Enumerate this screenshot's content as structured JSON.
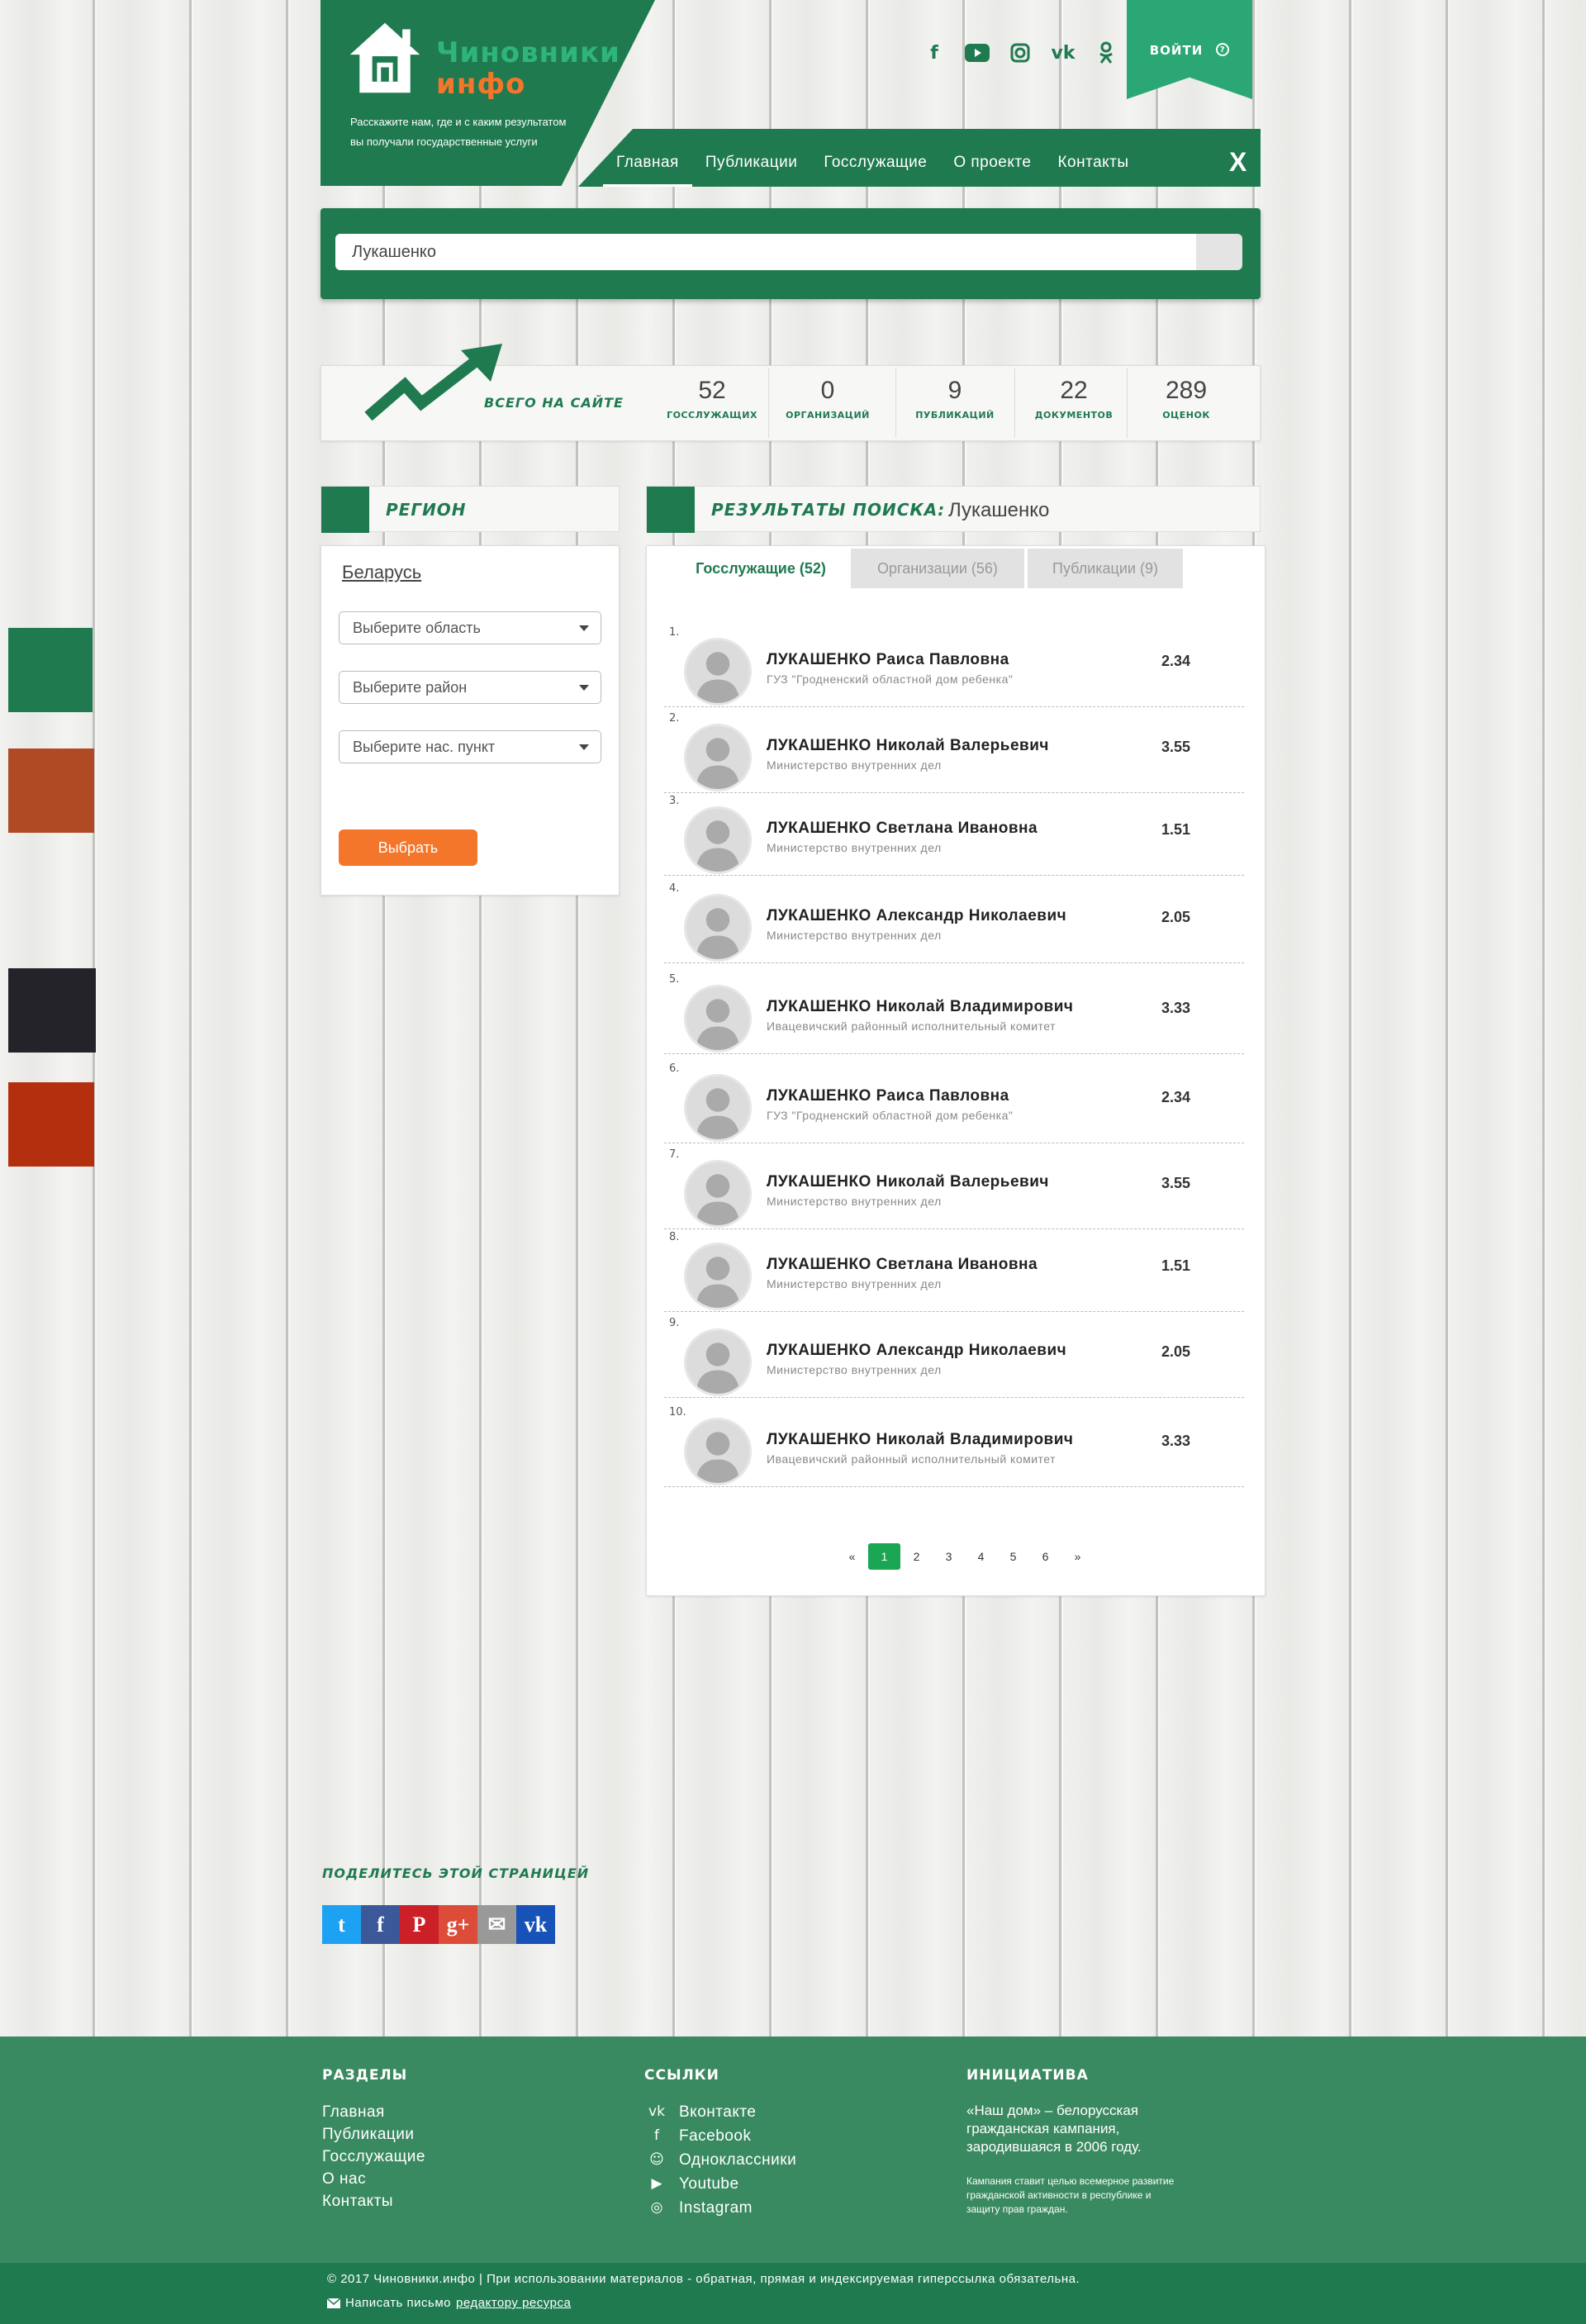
{
  "header": {
    "logo_line1": "Чиновники",
    "logo_line2": "инфо",
    "tagline": "Расскажите нам, где и с каким результатом вы получали государственные услуги",
    "login_label": "войти",
    "help_symbol": "?",
    "close_label": "X",
    "social_icons": [
      "facebook-icon",
      "youtube-icon",
      "instagram-icon",
      "vk-icon",
      "odnoklassniki-icon"
    ]
  },
  "nav": {
    "items": [
      "Главная",
      "Публикации",
      "Госслужащие",
      "О проекте",
      "Контакты"
    ],
    "active_index": 0
  },
  "search": {
    "value": "Лукашенко"
  },
  "stats": {
    "label": "всего на сайте",
    "items": [
      {
        "value": "52",
        "label": "госслужащих"
      },
      {
        "value": "0",
        "label": "организаций"
      },
      {
        "value": "9",
        "label": "публикаций"
      },
      {
        "value": "22",
        "label": "документов"
      },
      {
        "value": "289",
        "label": "оценок"
      }
    ]
  },
  "region": {
    "title": "регион",
    "country": "Беларусь",
    "select_region": "Выберите область",
    "select_district": "Выберите район",
    "select_locality": "Выберите нас. пункт",
    "submit_label": "Выбрать"
  },
  "results": {
    "title": "результаты поиска:",
    "query": "Лукашенко",
    "tabs": [
      "Госслужащие (52)",
      "Организации (56)",
      "Публикации (9)"
    ],
    "rows": [
      {
        "idx": "1.",
        "name": "ЛУКАШЕНКО Раиса Павловна",
        "org": "ГУЗ \"Гродненский областной дом ребенка\"",
        "score": "2.34"
      },
      {
        "idx": "2.",
        "name": "ЛУКАШЕНКО Николай Валерьевич",
        "org": "Министерство внутренних дел",
        "score": "3.55"
      },
      {
        "idx": "3.",
        "name": "ЛУКАШЕНКО Светлана Ивановна",
        "org": "Министерство внутренних дел",
        "score": "1.51"
      },
      {
        "idx": "4.",
        "name": "ЛУКАШЕНКО Александр Николаевич",
        "org": "Министерство внутренних дел",
        "score": "2.05"
      },
      {
        "idx": "5.",
        "name": "ЛУКАШЕНКО Николай Владимирович",
        "org": "Ивацевичский районный исполнительный комитет",
        "score": "3.33"
      },
      {
        "idx": "6.",
        "name": "ЛУКАШЕНКО Раиса Павловна",
        "org": "ГУЗ \"Гродненский областной дом ребенка\"",
        "score": "2.34"
      },
      {
        "idx": "7.",
        "name": "ЛУКАШЕНКО Николай Валерьевич",
        "org": "Министерство внутренних дел",
        "score": "3.55"
      },
      {
        "idx": "8.",
        "name": "ЛУКАШЕНКО Светлана Ивановна",
        "org": "Министерство внутренних дел",
        "score": "1.51"
      },
      {
        "idx": "9.",
        "name": "ЛУКАШЕНКО Александр Николаевич",
        "org": "Министерство внутренних дел",
        "score": "2.05"
      },
      {
        "idx": "10.",
        "name": "ЛУКАШЕНКО Николай Владимирович",
        "org": "Ивацевичский районный исполнительный комитет",
        "score": "3.33"
      }
    ],
    "pagination": [
      "«",
      "1",
      "2",
      "3",
      "4",
      "5",
      "6",
      "»"
    ],
    "current_page": "1"
  },
  "palette": [
    "#1f7a50",
    "#b04a25",
    "#24232a",
    "#b32f0e"
  ],
  "share": {
    "title": "поделитесь этой страницей",
    "buttons": [
      {
        "icon": "twitter-icon",
        "color": "#1da1f2"
      },
      {
        "icon": "facebook-icon",
        "color": "#3b5998"
      },
      {
        "icon": "pinterest-icon",
        "color": "#cb2027"
      },
      {
        "icon": "google-plus-icon",
        "color": "#dd4b39"
      },
      {
        "icon": "email-icon",
        "color": "#999999"
      },
      {
        "icon": "vk-icon",
        "color": "#1652b8"
      }
    ]
  },
  "footer": {
    "sections_title": "разделы",
    "sections": [
      "Главная",
      "Публикации",
      "Госслужащие",
      "О нас",
      "Контакты"
    ],
    "links_title": "ссылки",
    "links": [
      "Вконтакте",
      "Facebook",
      "Одноклассники",
      "Youtube",
      "Instagram"
    ],
    "initiative_title": "инициатива",
    "initiative_text1": "«Наш дом» – белорусская гражданская кампания, зародившаяся в 2006 году.",
    "initiative_text2": "Кампания ставит целью всемерное развитие гражданской активности в республике и защиту прав граждан.",
    "copyright": "© 2017 Чиновники.инфо | При использовании материалов - обратная, прямая и индексируемая гиперссылка обязательна.",
    "mail_prefix": "Написать письмо",
    "mail_link": "редактору ресурса"
  }
}
